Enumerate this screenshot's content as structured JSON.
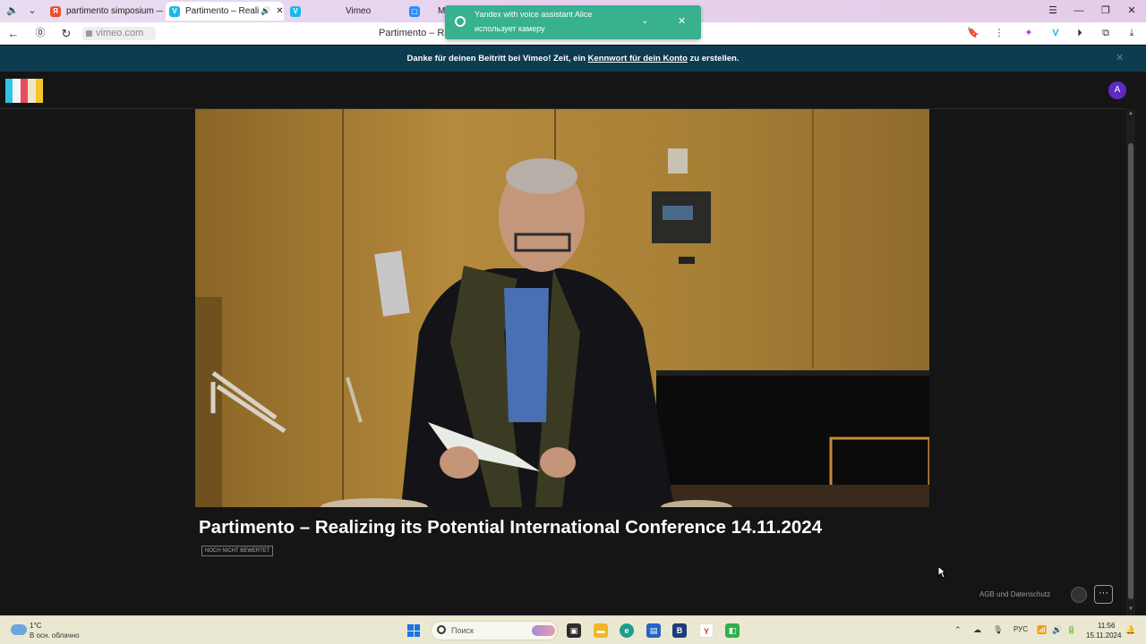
{
  "tabs": [
    {
      "title": "partimento simposium — ",
      "favicon": "Я",
      "favicon_color": "#e8502e"
    },
    {
      "title": "Partimento – Realiz",
      "favicon": "V",
      "favicon_color": "#1ab7ea"
    },
    {
      "title": "Vimeo",
      "favicon": "V",
      "favicon_color": "#1ab7ea"
    },
    {
      "title": "M",
      "favicon": "▢",
      "favicon_color": "#2d8cff"
    }
  ],
  "address": {
    "url": "vimeo.com",
    "page_title": "Partimento – Realizing its Potential International Conference 14.11.2024"
  },
  "toast": {
    "line1": "Yandex with voice assistant Alice",
    "line2": "использует камеру"
  },
  "banner": {
    "text_before": "Danke für deinen Beitritt bei Vimeo! Zeit, ein ",
    "link": "Kennwort für dein Konto",
    "text_after": " zu erstellen."
  },
  "header": {
    "avatar_letter": "A",
    "logo_colors": [
      "#2ec4e4",
      "#f5f5f5",
      "#e84b5d",
      "#f0e4c8",
      "#f4c52b"
    ]
  },
  "video": {
    "title": "Partimento – Realizing its Potential International Conference 14.11.2024",
    "rating_badge": "NOCH NICHT BEWERTET"
  },
  "footer": {
    "agb": "AGB und Datenschutz",
    "more": "···"
  },
  "taskbar": {
    "temperature": "1°C",
    "weather": "В осн. облачно",
    "search_placeholder": "Поиск",
    "language": "РУС",
    "time": "11:56",
    "date": "15.11.2024"
  }
}
